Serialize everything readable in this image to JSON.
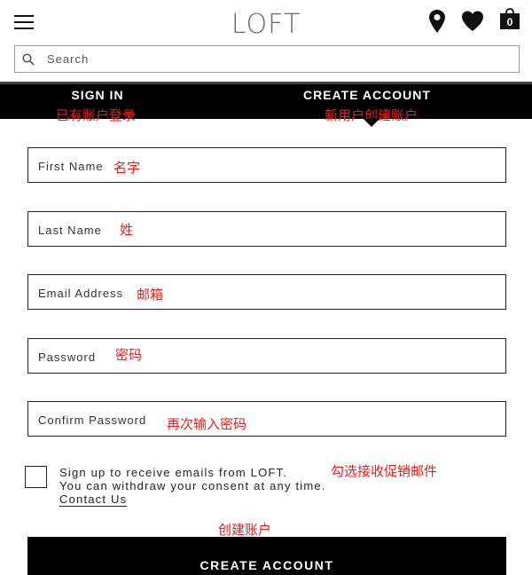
{
  "header": {
    "logo": "LOFT",
    "bag_count": "0"
  },
  "search": {
    "placeholder": "Search"
  },
  "tabs": {
    "signin_label": "SIGN IN",
    "signin_note": "已有账户登录",
    "create_label": "CREATE ACCOUNT",
    "create_note": "新用户创建账户"
  },
  "form": {
    "fields": [
      {
        "label": "First Name",
        "note": "名字"
      },
      {
        "label": "Last Name",
        "note": "姓"
      },
      {
        "label": "Email Address",
        "note": "邮箱"
      },
      {
        "label": "Password",
        "note": "密码"
      },
      {
        "label": "Confirm Password",
        "note": "再次输入密码"
      }
    ],
    "consent_line1": "Sign up to receive emails from LOFT.",
    "consent_line2": "You can withdraw your consent at any time.",
    "consent_link": "Contact Us",
    "consent_note": "勾选接收促销邮件",
    "button_note": "创建账户",
    "button_label": "CREATE ACCOUNT"
  },
  "colors": {
    "annotation": "#e0211c",
    "tabbar": "#000000"
  }
}
